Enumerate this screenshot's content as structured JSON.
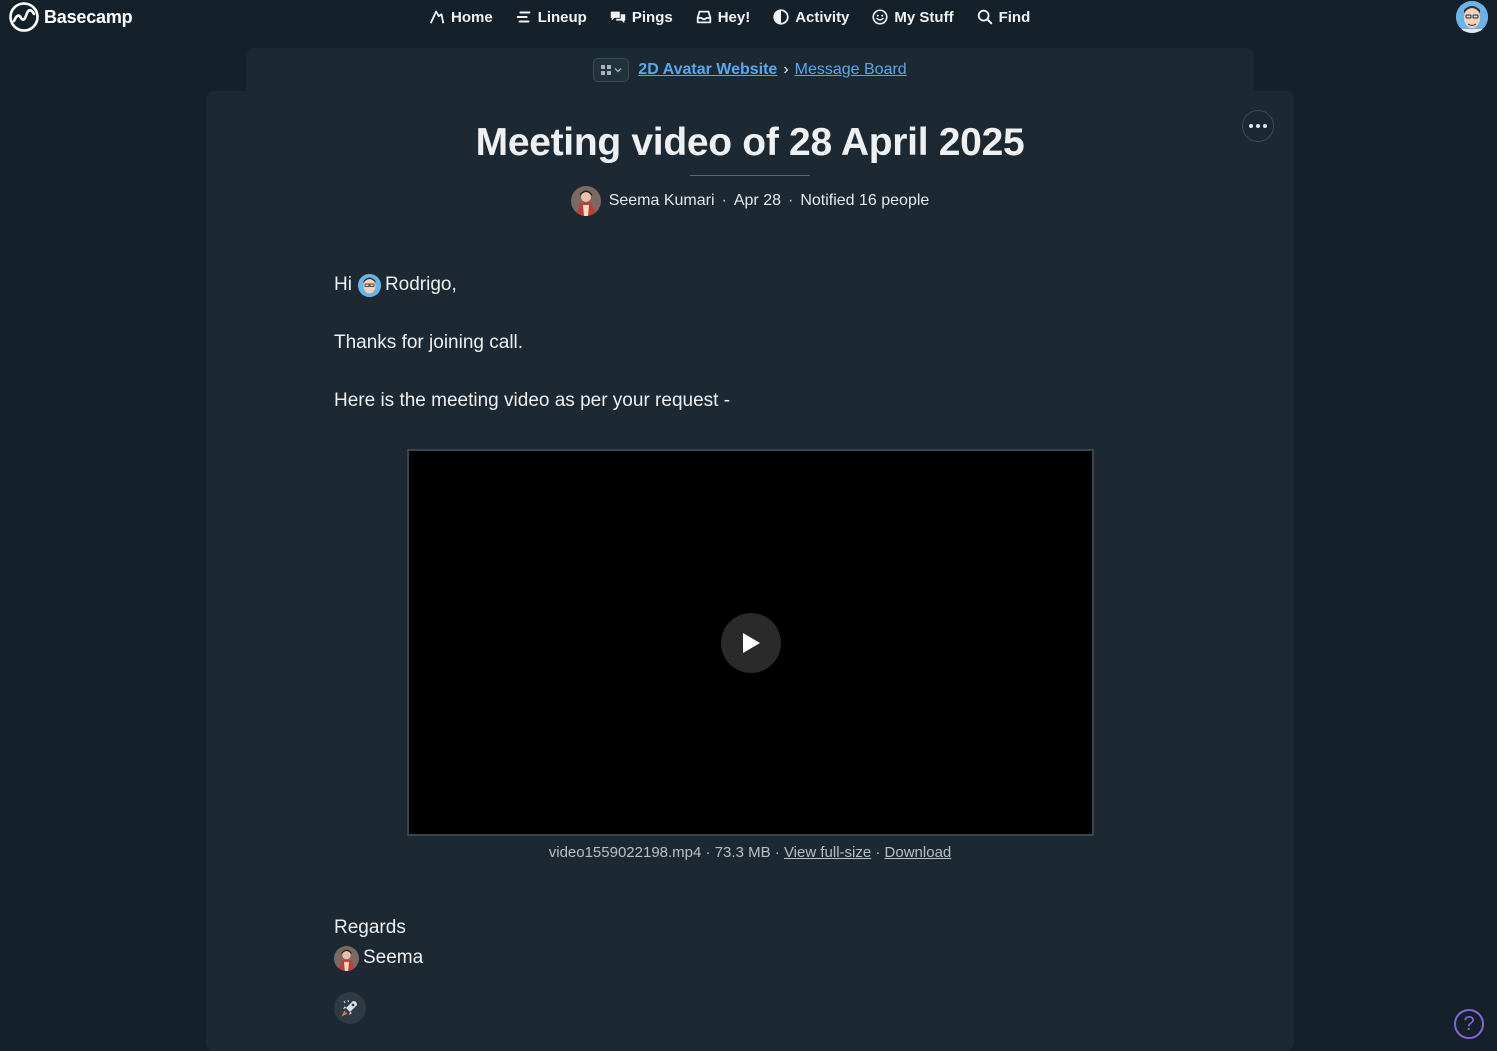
{
  "app": {
    "name": "Basecamp"
  },
  "nav": {
    "items": [
      {
        "label": "Home",
        "icon": "home-icon"
      },
      {
        "label": "Lineup",
        "icon": "lineup-icon"
      },
      {
        "label": "Pings",
        "icon": "pings-icon"
      },
      {
        "label": "Hey!",
        "icon": "hey-inbox-icon"
      },
      {
        "label": "Activity",
        "icon": "activity-icon"
      },
      {
        "label": "My Stuff",
        "icon": "smiley-icon"
      },
      {
        "label": "Find",
        "icon": "search-icon"
      }
    ]
  },
  "breadcrumb": {
    "project": "2D Avatar Website",
    "separator": "›",
    "section": "Message Board"
  },
  "message": {
    "title": "Meeting video of 28 April 2025",
    "author": "Seema Kumari",
    "date": "Apr 28",
    "notified": "Notified 16 people",
    "separator": "·",
    "greeting": "Hi",
    "mention": "Rodrigo,",
    "line1": "Thanks for joining call.",
    "line2": "Here is the meeting video as per your request -",
    "attachment": {
      "filename": "video1559022198.mp4",
      "size": "73.3 MB",
      "view_label": "View full-size",
      "download_label": "Download",
      "separator": "·"
    },
    "regards": "Regards",
    "signature": "Seema"
  },
  "help": {
    "label": "?"
  },
  "colors": {
    "background": "#15212a",
    "card": "#1c2933",
    "link": "#5aa7ee",
    "help_accent": "#8a62d8"
  }
}
